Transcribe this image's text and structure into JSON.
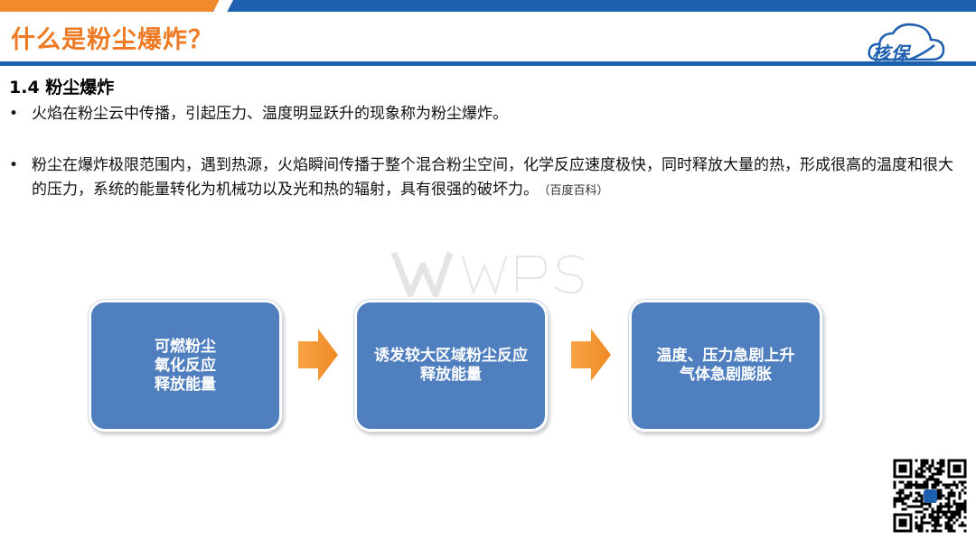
{
  "slide": {
    "title": "什么是粉尘爆炸？",
    "logo_text": "核保",
    "section_heading": "1.4 粉尘爆炸",
    "bullet_marker": "•",
    "bullets": [
      {
        "text": "火焰在粉尘云中传播，引起压力、温度明显跃升的现象称为粉尘爆炸。"
      },
      {
        "text": "粉尘在爆炸极限范围内，遇到热源，火焰瞬间传播于整个混合粉尘空间，化学反应速度极快，同时释放大量的热，形成很高的温度和很大的压力，系统的能量转化为机械功以及光和热的辐射，具有很强的破坏力。",
        "source": "（百度百科）"
      }
    ]
  },
  "flow": {
    "boxes": [
      {
        "lines": [
          "可燃粉尘",
          "氧化反应",
          "释放能量"
        ]
      },
      {
        "lines": [
          "诱发较大区域粉尘反应",
          "释放能量"
        ]
      },
      {
        "lines": [
          "温度、压力急剧上升",
          "气体急剧膨胀"
        ]
      }
    ],
    "arrow_icon": "right-arrow-icon"
  },
  "watermark": {
    "icon": "wps-watermark-icon"
  },
  "qr": {
    "icon": "qr-code-icon"
  },
  "colors": {
    "title_orange": "#ee7a24",
    "brand_blue": "#1f5fb0",
    "box_blue": "#4f7fbe",
    "arrow_orange": "#f28b24"
  }
}
